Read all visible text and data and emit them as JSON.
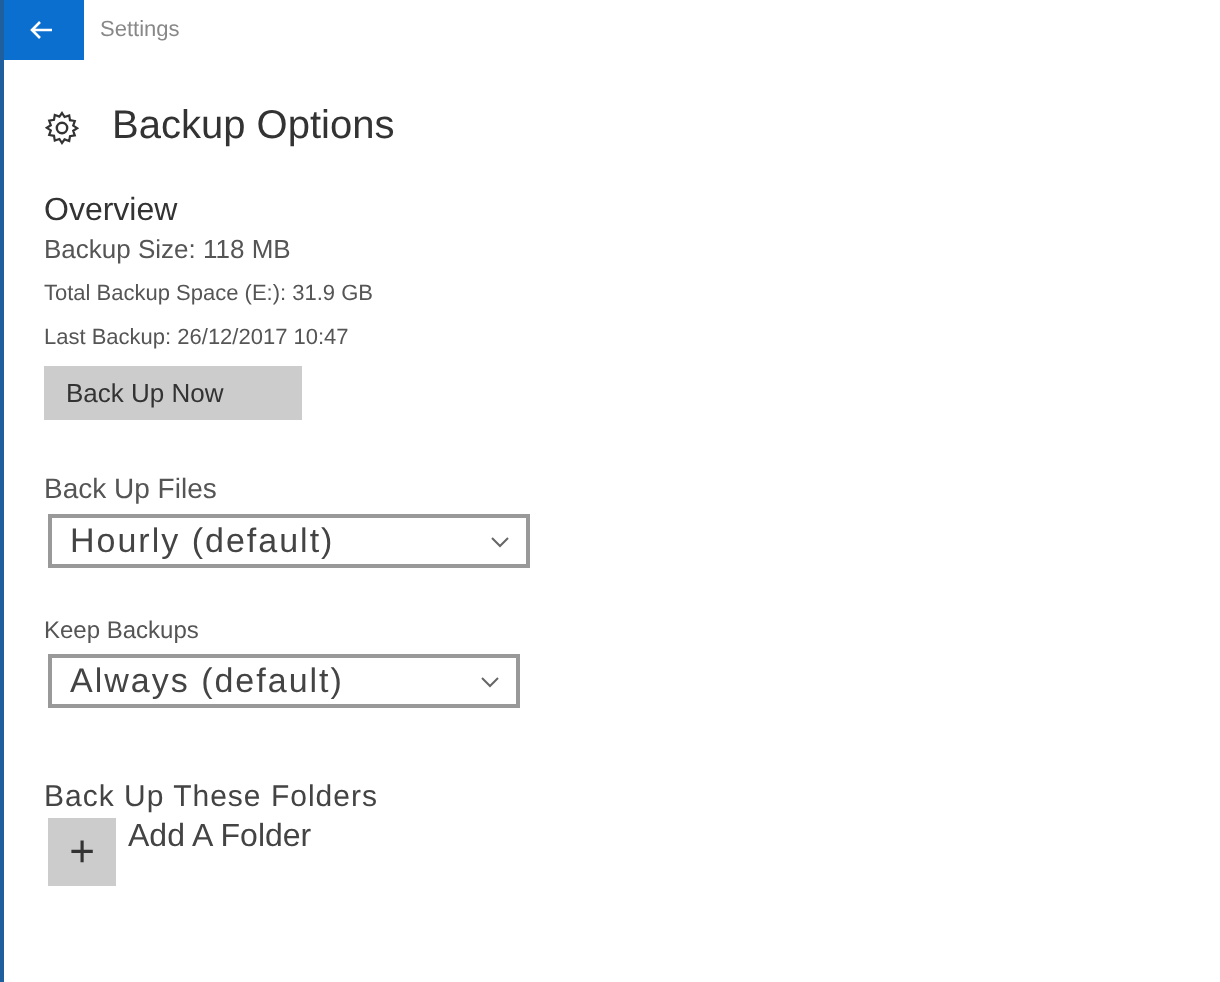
{
  "window": {
    "title": "Settings"
  },
  "page": {
    "title": "Backup Options"
  },
  "overview": {
    "heading": "Overview",
    "backup_size": "Backup Size: 118 MB",
    "total_space": "Total Backup Space (E:): 31.9 GB",
    "last_backup": "Last Backup: 26/12/2017 10:47",
    "button": "Back Up Now"
  },
  "dropdowns": [
    {
      "label": "Back Up Files",
      "value": "Hourly (default)"
    },
    {
      "label": "Keep Backups",
      "value": "Always (default)"
    }
  ],
  "folders": {
    "heading": "Back Up These Folders",
    "add_glyph": "+",
    "add_label": "Add A Folder"
  }
}
